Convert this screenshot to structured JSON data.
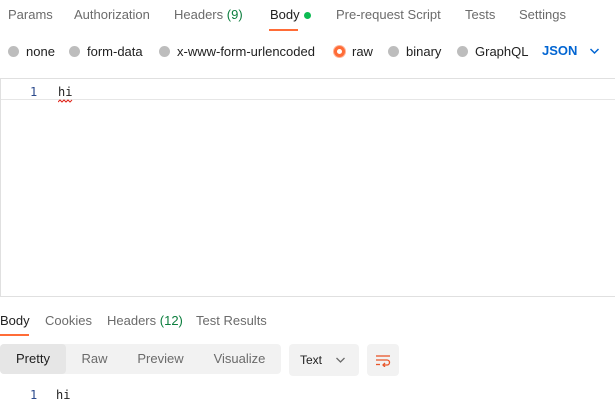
{
  "request_tabs": {
    "params": "Params",
    "authorization": "Authorization",
    "headers": "Headers",
    "headers_count": "(9)",
    "body": "Body",
    "pre_request": "Pre-request Script",
    "tests": "Tests",
    "settings": "Settings"
  },
  "body_types": {
    "none": "none",
    "form_data": "form-data",
    "urlencoded": "x-www-form-urlencoded",
    "raw": "raw",
    "binary": "binary",
    "graphql": "GraphQL",
    "selected": "raw",
    "language": "JSON"
  },
  "editor": {
    "line_number": "1",
    "content": "hi"
  },
  "response_tabs": {
    "body": "Body",
    "cookies": "Cookies",
    "headers": "Headers",
    "headers_count": "(12)",
    "test_results": "Test Results"
  },
  "response_toolbar": {
    "pretty": "Pretty",
    "raw": "Raw",
    "preview": "Preview",
    "visualize": "Visualize",
    "format": "Text"
  },
  "response_body": {
    "line_number": "1",
    "content": "hi"
  },
  "colors": {
    "accent": "#ff6c37",
    "count_green": "#0c7e3e",
    "link_blue": "#0265d2"
  },
  "icons": {
    "body_status": "green-dot-icon",
    "language_dropdown": "chevron-down-icon",
    "format_dropdown": "chevron-down-icon",
    "wrap": "wrap-lines-icon"
  }
}
